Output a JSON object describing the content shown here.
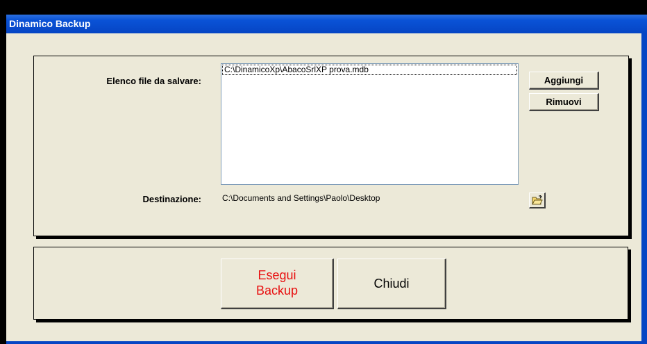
{
  "window": {
    "title": "Dinamico Backup"
  },
  "files": {
    "label": "Elenco file da salvare:",
    "items": [
      "C:\\DinamicoXp\\AbacoSrlXP prova.mdb"
    ],
    "add_label": "Aggiungi",
    "remove_label": "Rimuovi"
  },
  "destination": {
    "label": "Destinazione:",
    "value": "C:\\Documents and Settings\\Paolo\\Desktop",
    "browse_icon": "folder-open-icon"
  },
  "actions": {
    "backup_line1": "Esegui",
    "backup_line2": "Backup",
    "close_label": "Chiudi"
  },
  "colors": {
    "title_bar": "#0a52d6",
    "client_bg": "#ece9d8",
    "backup_text": "#e81010"
  }
}
